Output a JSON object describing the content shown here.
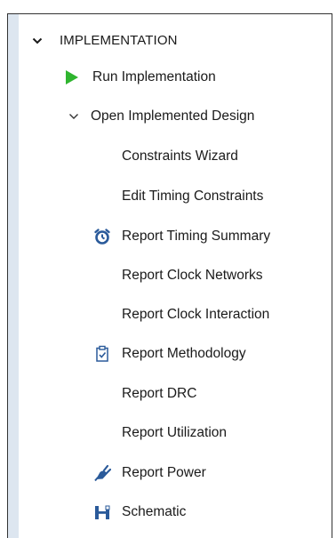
{
  "section": {
    "label": "IMPLEMENTATION",
    "chevron_icon": "chevron-down-icon"
  },
  "run_item": {
    "label": "Run Implementation",
    "icon": "play-icon",
    "icon_color": "#2fb52f"
  },
  "open_item": {
    "label": "Open Implemented Design",
    "chevron_icon": "chevron-down-icon"
  },
  "children": [
    {
      "label": "Constraints Wizard",
      "icon": ""
    },
    {
      "label": "Edit Timing Constraints",
      "icon": ""
    },
    {
      "label": "Report Timing Summary",
      "icon": "alarm-clock-icon"
    },
    {
      "label": "Report Clock Networks",
      "icon": ""
    },
    {
      "label": "Report Clock Interaction",
      "icon": ""
    },
    {
      "label": "Report Methodology",
      "icon": "clipboard-check-icon"
    },
    {
      "label": "Report DRC",
      "icon": ""
    },
    {
      "label": "Report Utilization",
      "icon": ""
    },
    {
      "label": "Report Power",
      "icon": "power-plug-icon"
    },
    {
      "label": "Schematic",
      "icon": "schematic-icon"
    }
  ],
  "colors": {
    "icon_blue": "#2a5a9a",
    "text": "#1a1a1a",
    "strip": "#dde6f0"
  }
}
